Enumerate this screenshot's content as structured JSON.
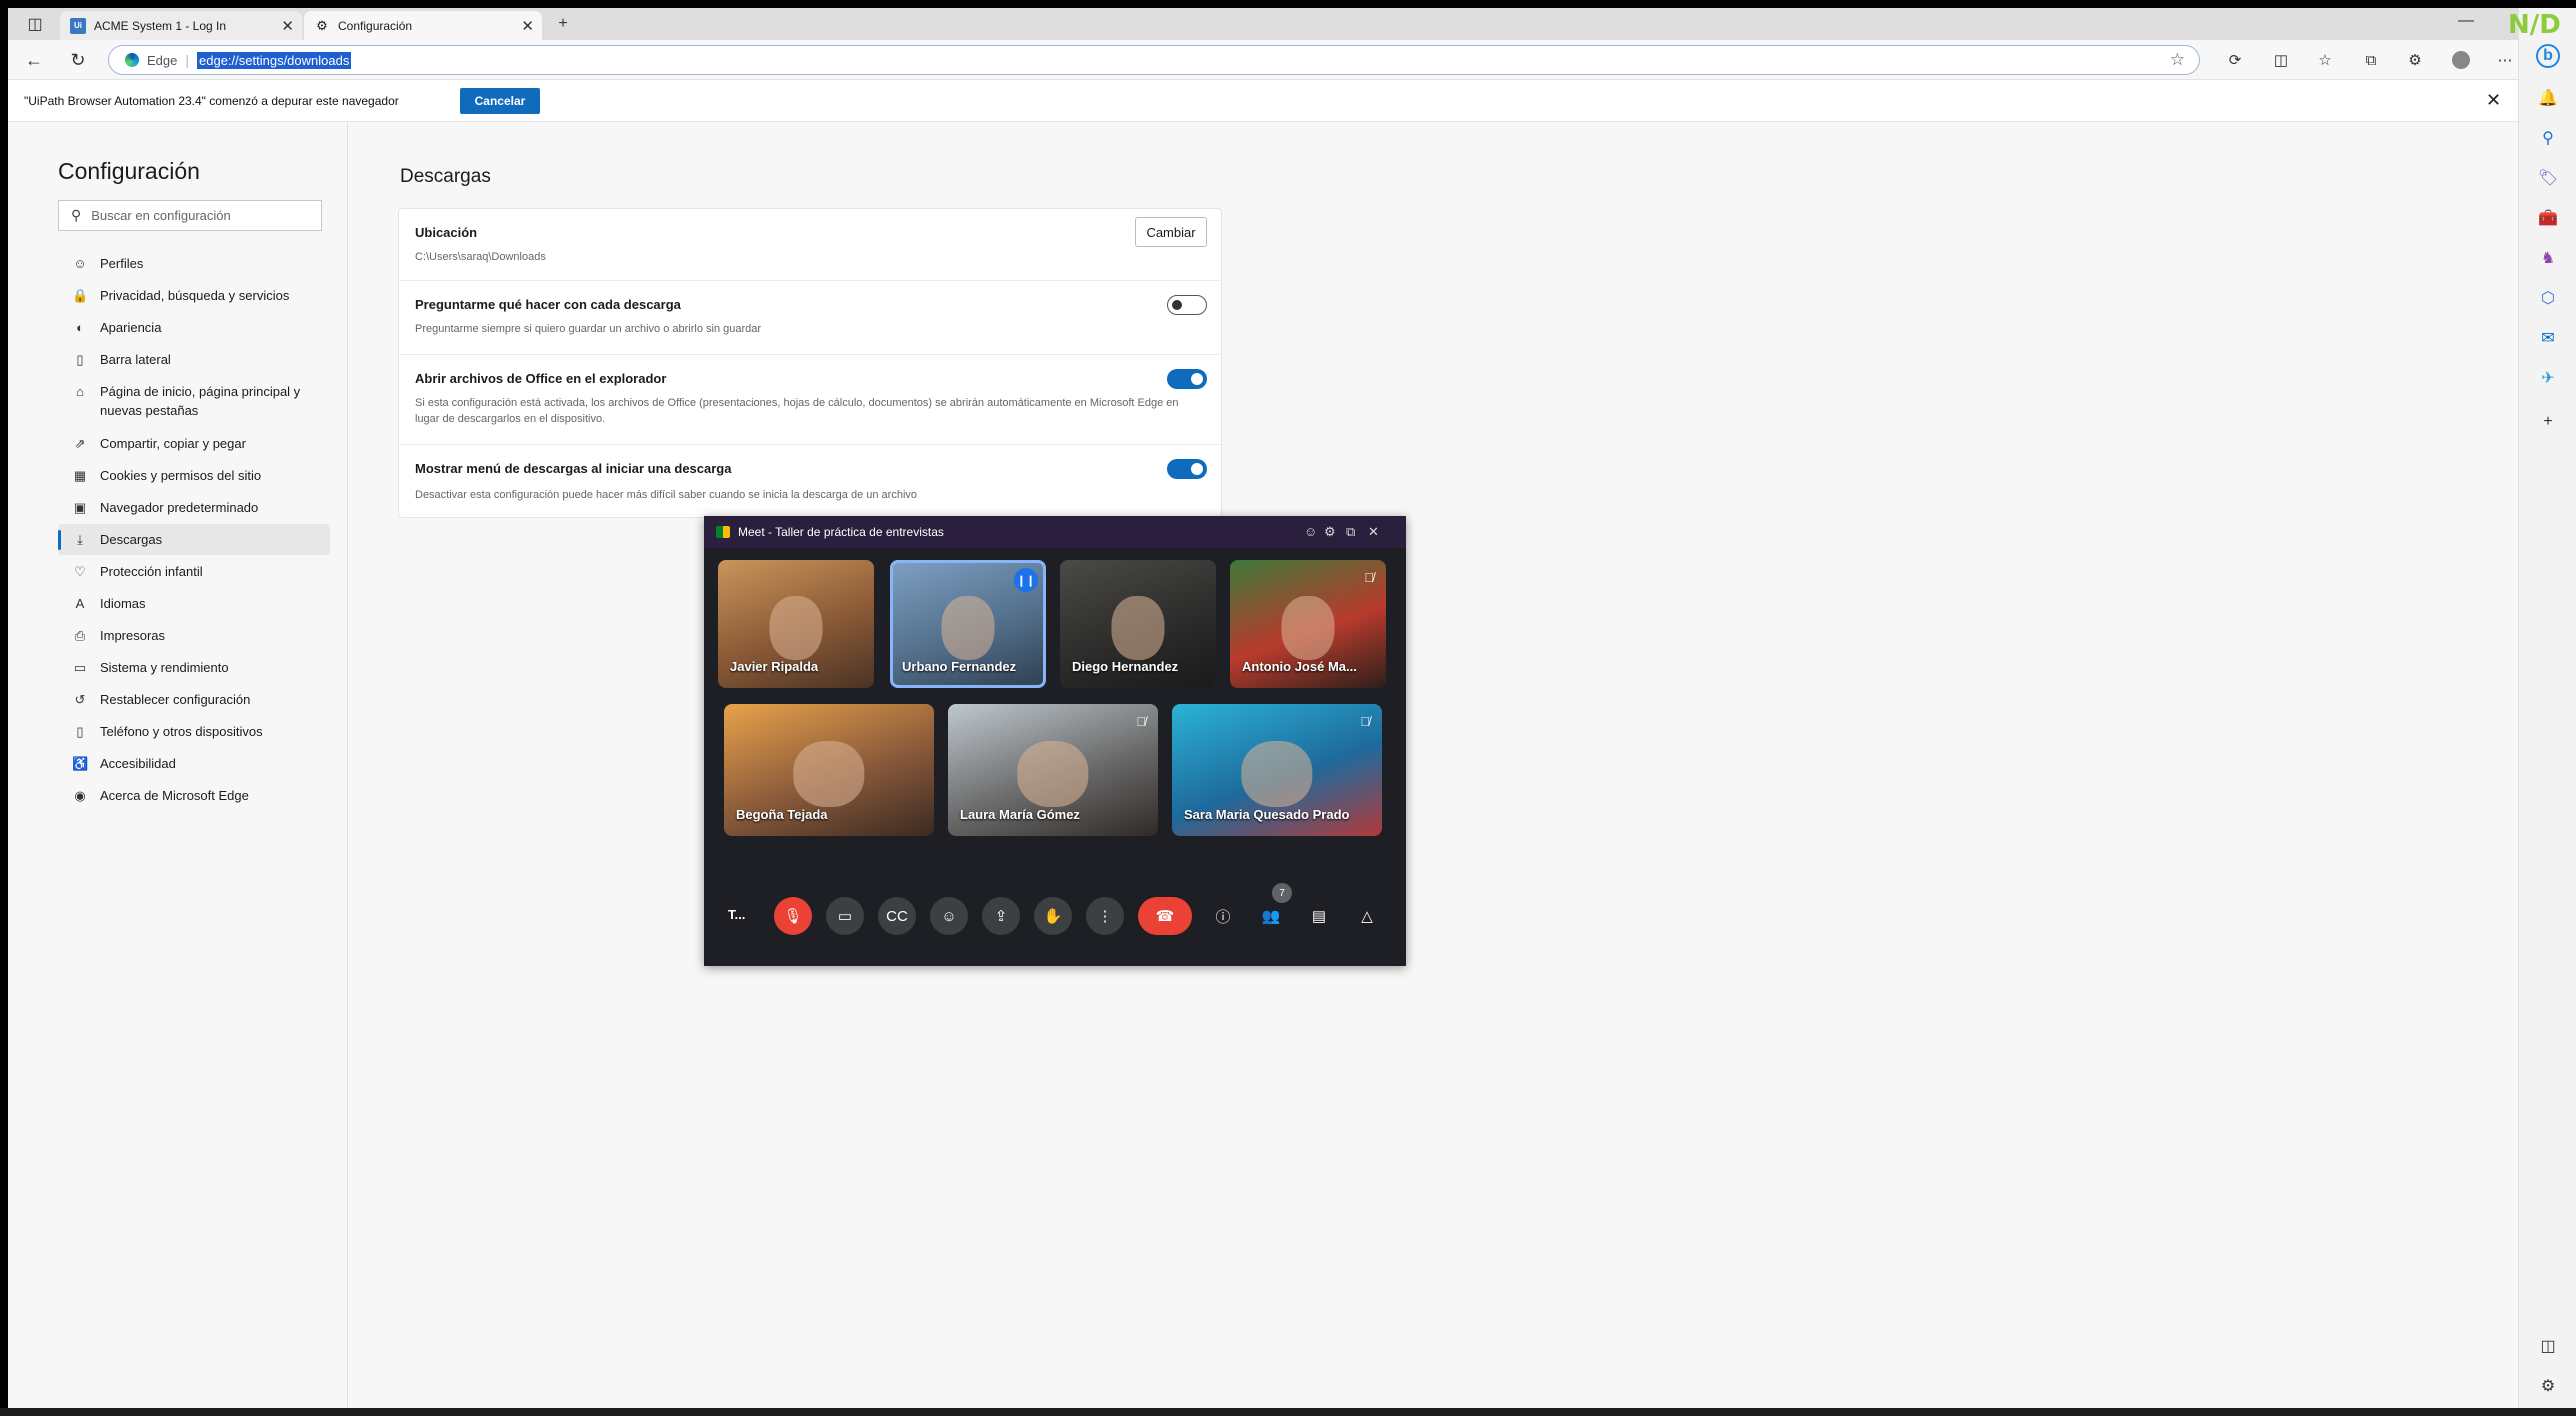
{
  "tabs": [
    {
      "label": "ACME System 1 - Log In",
      "icon": "ui-icon",
      "active": false
    },
    {
      "label": "Configuración",
      "icon": "gear-icon",
      "active": true
    }
  ],
  "address": {
    "site_label": "Edge",
    "url": "edge://settings/downloads"
  },
  "infobar": {
    "message": "\"UiPath Browser Automation 23.4\" comenzó a depurar este navegador",
    "cancel_label": "Cancelar"
  },
  "settings": {
    "title": "Configuración",
    "search_placeholder": "Buscar en configuración",
    "nav": [
      {
        "label": "Perfiles",
        "icon": "profile-icon"
      },
      {
        "label": "Privacidad, búsqueda y servicios",
        "icon": "lock-icon"
      },
      {
        "label": "Apariencia",
        "icon": "palette-icon"
      },
      {
        "label": "Barra lateral",
        "icon": "sidebar-icon"
      },
      {
        "label": "Página de inicio, página principal y nuevas pestañas",
        "icon": "home-icon"
      },
      {
        "label": "Compartir, copiar y pegar",
        "icon": "share-icon"
      },
      {
        "label": "Cookies y permisos del sitio",
        "icon": "cookie-icon"
      },
      {
        "label": "Navegador predeterminado",
        "icon": "browser-icon"
      },
      {
        "label": "Descargas",
        "icon": "download-icon"
      },
      {
        "label": "Protección infantil",
        "icon": "family-icon"
      },
      {
        "label": "Idiomas",
        "icon": "language-icon"
      },
      {
        "label": "Impresoras",
        "icon": "printer-icon"
      },
      {
        "label": "Sistema y rendimiento",
        "icon": "laptop-icon"
      },
      {
        "label": "Restablecer configuración",
        "icon": "reset-icon"
      },
      {
        "label": "Teléfono y otros dispositivos",
        "icon": "phone-icon"
      },
      {
        "label": "Accesibilidad",
        "icon": "accessibility-icon"
      },
      {
        "label": "Acerca de Microsoft Edge",
        "icon": "edge-icon"
      }
    ],
    "selected": "Descargas",
    "section_title": "Descargas",
    "rows": [
      {
        "title": "Ubicación",
        "desc": "C:\\Users\\saraq\\Downloads",
        "button": "Cambiar"
      },
      {
        "title": "Preguntarme qué hacer con cada descarga",
        "desc": "Preguntarme siempre si quiero guardar un archivo o abrirlo sin guardar",
        "toggle": false
      },
      {
        "title": "Abrir archivos de Office en el explorador",
        "desc": "Si esta configuración está activada, los archivos de Office (presentaciones, hojas de cálculo, documentos) se abrirán automáticamente en Microsoft Edge en lugar de descargarlos en el dispositivo.",
        "toggle": true
      },
      {
        "title": "Mostrar menú de descargas al iniciar una descarga",
        "desc": "Desactivar esta configuración puede hacer más difícil saber cuando se inicia la descarga de un archivo",
        "toggle": true
      }
    ]
  },
  "meet": {
    "title": "Meet - Taller de práctica de entrevistas",
    "participants": [
      {
        "name": "Javier Ripalda",
        "muted": false
      },
      {
        "name": "Urbano Fernandez",
        "muted": false,
        "speaking": true
      },
      {
        "name": "Diego Hernandez",
        "muted": false
      },
      {
        "name": "Antonio José Ma...",
        "muted": true
      },
      {
        "name": "Begoña Tejada",
        "muted": false
      },
      {
        "name": "Laura María Gómez",
        "muted": true
      },
      {
        "name": "Sara Maria Quesado Prado",
        "muted": true
      }
    ],
    "self_label": "T...",
    "participant_count": "7"
  },
  "overlay_text": "N/D",
  "colors": {
    "accent": "#0f6cbd",
    "meet_bg": "#1e1f24",
    "hangup": "#ea4335"
  }
}
